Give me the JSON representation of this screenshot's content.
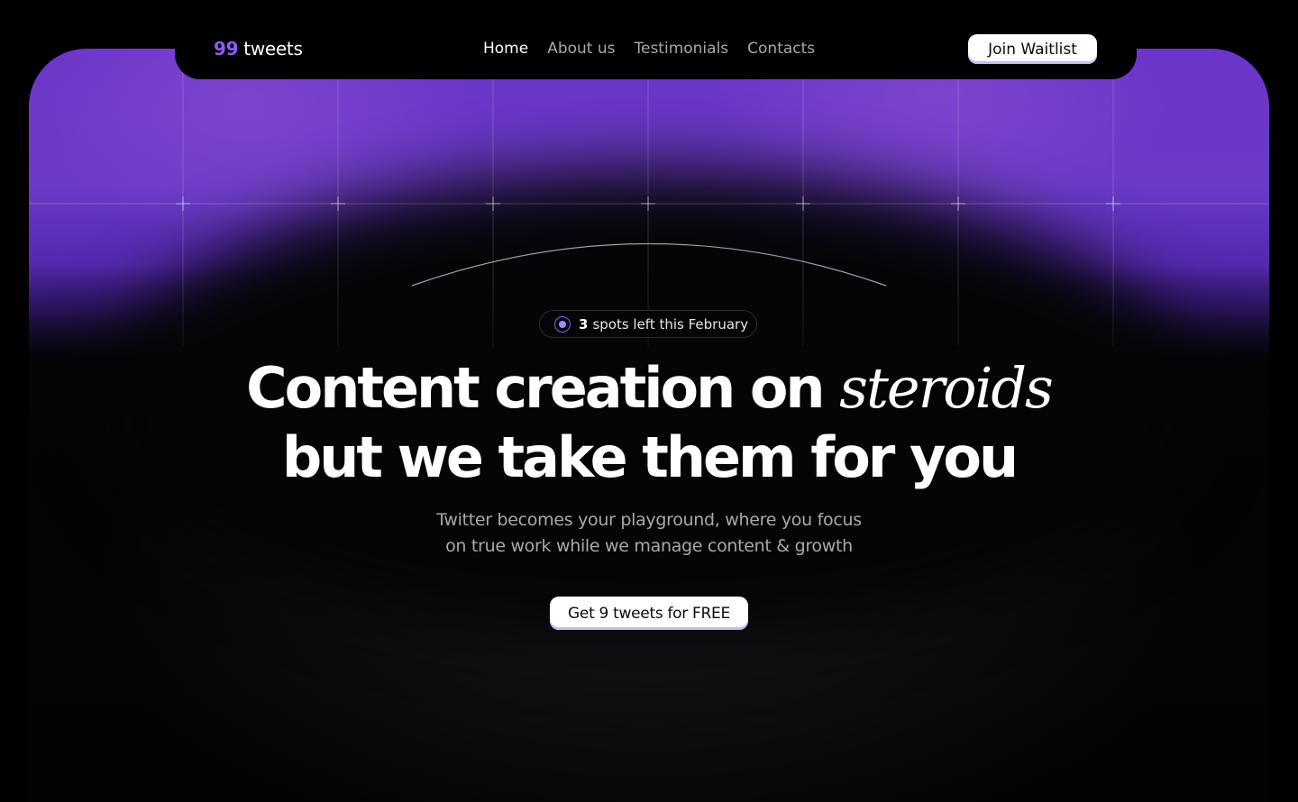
{
  "navbar": {
    "logo_number": "99",
    "logo_text": "tweets",
    "links": [
      "Home",
      "About us",
      "Testimonials",
      "Contacts"
    ],
    "active_link": "Home",
    "cta_label": "Join Waitlist"
  },
  "hero": {
    "badge": {
      "count": "3",
      "text": "spots left this February"
    },
    "headline_line1": "Content creation on ",
    "headline_emphasis": "steroids",
    "headline_line2": "but we take them for you",
    "subtitle_line1": "Twitter becomes your playground, where you focus",
    "subtitle_line2": "on true work while we manage content & growth",
    "cta_label": "Get 9 tweets for FREE"
  },
  "colors": {
    "background": "#000000",
    "accent_purple": "#8b5cf6",
    "hero_purple": "#6a35c8",
    "button_bg": "#ffffff",
    "muted_text": "#a8a8ae"
  },
  "icons": {
    "badge_icon": "radio-dot-icon"
  }
}
